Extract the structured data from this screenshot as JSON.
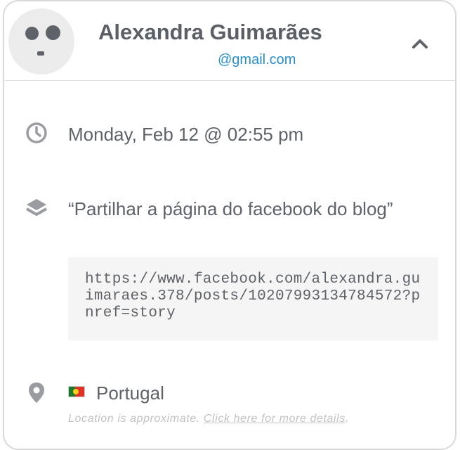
{
  "contact": {
    "name": "Alexandra Guimarães",
    "email": "@gmail.com"
  },
  "header": {
    "toggle_icon": "chevron-up-icon"
  },
  "details": {
    "datetime": "Monday, Feb 12 @ 02:55 pm",
    "datetime_icon": "clock-icon",
    "task": "“Partilhar a página do facebook do blog”",
    "task_icon": "layers-icon",
    "url": "https://www.facebook.com/alexandra.guimaraes.378/posts/10207993134784572?pnref=story",
    "location_icon": "map-pin-icon",
    "country": "Portugal",
    "flag": "portugal-flag",
    "location_note": "Location is approximate.",
    "location_link": "Click here for more details",
    "location_link_suffix": "."
  },
  "colors": {
    "text": "#5f6268",
    "accent": "#2a8fd0",
    "muted": "#c2c2c2",
    "code_bg": "#f5f5f5"
  }
}
